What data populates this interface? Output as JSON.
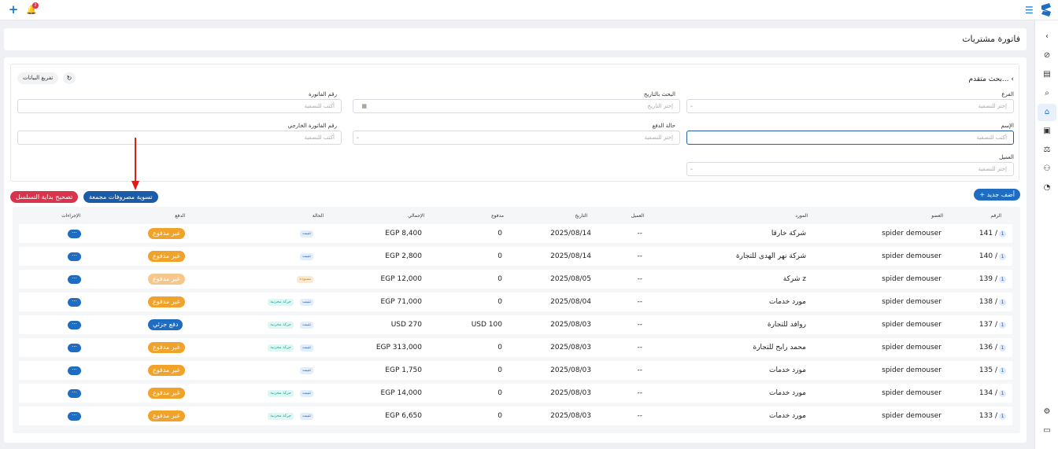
{
  "topbar": {
    "notif_count": "2"
  },
  "page": {
    "title": "فاتورة مشتريات"
  },
  "filters": {
    "advanced_label": "بحث متقدم...",
    "export_label": "تفريغ البيانات",
    "branch_label": "الفرع",
    "branch_placeholder": "إختر للتصفية",
    "date_label": "البحث بالتاريخ",
    "date_placeholder": "إختر التاريخ",
    "invoice_no_label": "رقم الفاتورة",
    "invoice_no_placeholder": "أكتب للتصفية",
    "name_label": "الإسم",
    "name_placeholder": "أكتب للتصفية",
    "pay_status_label": "حالة الدفع",
    "pay_status_placeholder": "إختر للتصفية",
    "ext_invoice_label": "رقم الفاتورة الخارجي",
    "ext_invoice_placeholder": "أكتب للتصفية",
    "client_label": "العميل",
    "client_placeholder": "إختر للتصفية"
  },
  "actions": {
    "add_new": "+ أضف جديد",
    "settle": "تسوية مصروفات مجمعة",
    "fix_sequence": "تصحيح بداية التسلسل"
  },
  "table": {
    "headers": {
      "number": "الرقم",
      "member": "العضو",
      "supplier": "المورد",
      "client": "العميل",
      "date": "التاريخ",
      "paid": "مدفوع",
      "total": "الإجمالي",
      "status": "الحالة",
      "payment": "الدفع",
      "actions": "الإجراءات"
    },
    "rows": [
      {
        "num": "141 /",
        "badge": "1",
        "member": "spider demouser",
        "supplier": "شركة خارقا",
        "client": "--",
        "date": "2025/08/14",
        "paid": "0",
        "total": "EGP 8,400",
        "tags": [
          "تثبيت"
        ],
        "payment": "غير مدفوع",
        "payment_type": "unpaid",
        "action": "···"
      },
      {
        "num": "140 /",
        "badge": "1",
        "member": "spider demouser",
        "supplier": "شركة  نهر الهدى للتجارة",
        "client": "--",
        "date": "2025/08/14",
        "paid": "0",
        "total": "EGP 2,800",
        "tags": [
          "تثبيت"
        ],
        "payment": "غير مدفوع",
        "payment_type": "unpaid",
        "action": "···"
      },
      {
        "num": "139 /",
        "badge": "1",
        "member": "spider demouser",
        "supplier": "شركة z",
        "client": "--",
        "date": "2025/08/05",
        "paid": "0",
        "total": "EGP 12,000",
        "tags": [
          "مسودة"
        ],
        "payment": "غير مدفوع",
        "payment_type": "unpaid-dim",
        "action": "···"
      },
      {
        "num": "138 /",
        "badge": "1",
        "member": "spider demouser",
        "supplier": "مورد خدمات",
        "client": "--",
        "date": "2025/08/04",
        "paid": "0",
        "total": "EGP 71,000",
        "tags": [
          "تثبيت",
          "حركة مخزنية"
        ],
        "payment": "غير مدفوع",
        "payment_type": "unpaid",
        "action": "···"
      },
      {
        "num": "137 /",
        "badge": "1",
        "member": "spider demouser",
        "supplier": "روافد للتجارة",
        "client": "--",
        "date": "2025/08/03",
        "paid": "USD 100",
        "total": "USD 270",
        "tags": [
          "تثبيت",
          "حركة مخزنية"
        ],
        "payment": "دفع جزئي",
        "payment_type": "partial",
        "action": "···"
      },
      {
        "num": "136 /",
        "badge": "1",
        "member": "spider demouser",
        "supplier": "محمد رابح للتجارة",
        "client": "--",
        "date": "2025/08/03",
        "paid": "0",
        "total": "EGP 313,000",
        "tags": [
          "تثبيت",
          "حركة مخزنية"
        ],
        "payment": "غير مدفوع",
        "payment_type": "unpaid",
        "action": "···"
      },
      {
        "num": "135 /",
        "badge": "1",
        "member": "spider demouser",
        "supplier": "مورد خدمات",
        "client": "--",
        "date": "2025/08/03",
        "paid": "0",
        "total": "EGP 1,750",
        "tags": [
          "تثبيت"
        ],
        "payment": "غير مدفوع",
        "payment_type": "unpaid",
        "action": "···"
      },
      {
        "num": "134 /",
        "badge": "1",
        "member": "spider demouser",
        "supplier": "مورد خدمات",
        "client": "--",
        "date": "2025/08/03",
        "paid": "0",
        "total": "EGP 14,000",
        "tags": [
          "تثبيت",
          "حركة مخزنية"
        ],
        "payment": "غير مدفوع",
        "payment_type": "unpaid",
        "action": "···"
      },
      {
        "num": "133 /",
        "badge": "1",
        "member": "spider demouser",
        "supplier": "مورد خدمات",
        "client": "--",
        "date": "2025/08/03",
        "paid": "0",
        "total": "EGP 6,650",
        "tags": [
          "تثبيت",
          "حركة مخزنية"
        ],
        "payment": "غير مدفوع",
        "payment_type": "unpaid",
        "action": "···"
      }
    ]
  },
  "colors": {
    "brand": "#1f6dc3",
    "unpaid": "#f0a22a",
    "danger": "#d9344b",
    "arrow": "#e01b1b"
  }
}
